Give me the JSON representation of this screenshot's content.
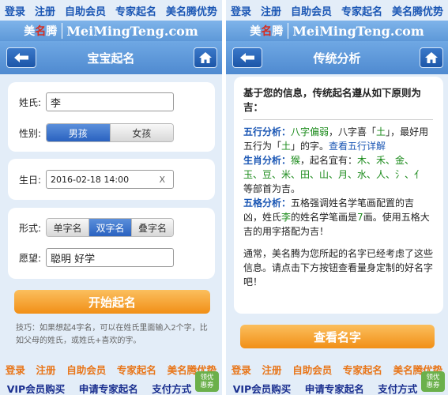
{
  "nav": [
    "登录",
    "注册",
    "自助会员",
    "专家起名",
    "美名腾优势"
  ],
  "brand": {
    "cn_1": "美",
    "cn_2": "名",
    "cn_3": "腾",
    "en": "MeiMingTeng.com"
  },
  "left": {
    "title": "宝宝起名",
    "surname_label": "姓氏:",
    "surname_value": "李",
    "gender_label": "性别:",
    "gender_options": [
      "男孩",
      "女孩"
    ],
    "gender_selected": "男孩",
    "birth_label": "生日:",
    "birth_value": "2016-02-18 14:00",
    "birth_clear": "X",
    "form_label": "形式:",
    "form_options": [
      "单字名",
      "双字名",
      "叠字名"
    ],
    "form_selected": "双字名",
    "wish_label": "愿望:",
    "wish_value": "聪明 好学",
    "start_button": "开始起名",
    "tip": "技巧：如果想起4字名，可以在姓氏里面输入2个字，比如父母的姓氏，或姓氏+喜欢的字。"
  },
  "right": {
    "title": "传统分析",
    "heading": "基于您的信息，传统起名遵从如下原则为吉：",
    "wuxing_key": "五行分析：",
    "wuxing_a": "八字偏弱",
    "wuxing_b": "，八字喜「",
    "wuxing_c": "土",
    "wuxing_d": "」，最好用五行为「",
    "wuxing_e": "土",
    "wuxing_f": "」的字。",
    "wuxing_link": "查看五行详解",
    "shengxiao_key": "生肖分析：",
    "shengxiao_a": "猴",
    "shengxiao_b": "，起名宜有：",
    "shengxiao_c": "木、禾、金、玉、豆、米、田、山、月、水、人、氵、亻",
    "shengxiao_d": " 等部首为吉。",
    "wuge_key": "五格分析：",
    "wuge_a": "五格强调姓名学笔画配置的吉凶，姓氏",
    "wuge_b": "李",
    "wuge_c": "的姓名学笔画是",
    "wuge_d": "7",
    "wuge_e": "画。使用五格大吉的用字搭配为吉！",
    "closing": "通常，美名腾为您所起的名字已经考虑了这些信息。请点击下方按钮查看量身定制的好名字吧！",
    "view_button": "查看名字"
  },
  "footer": {
    "links_top": [
      "登录",
      "注册",
      "自助会员",
      "专家起名",
      "美名腾优势"
    ],
    "links_bottom": [
      "VIP会员购买",
      "申请专家起名",
      "支付方式"
    ],
    "coupon_1": "领优",
    "coupon_2": "惠券"
  },
  "colors": {
    "accent_blue": "#4f8ad0",
    "orange_button": "#f18f16",
    "nav_text": "#1a56b4"
  }
}
